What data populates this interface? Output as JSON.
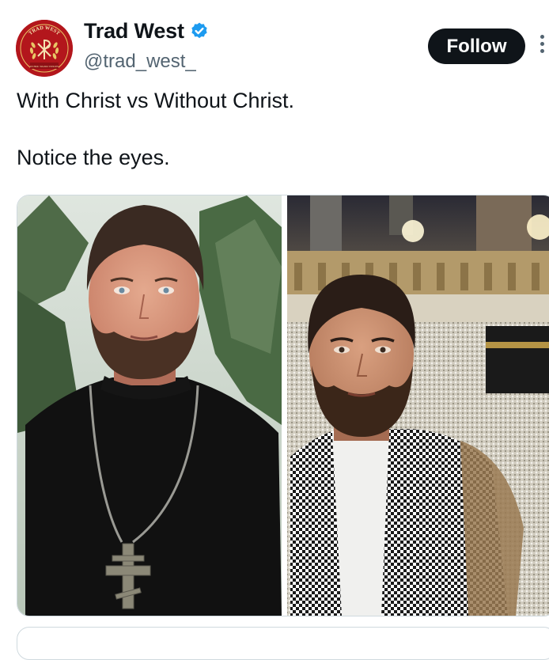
{
  "tweet": {
    "author_name": "Trad West",
    "verified": true,
    "handle": "@trad_west_",
    "follow_label": "Follow",
    "text_line1": "With Christ vs Without Christ.",
    "text_line2": "Notice the eyes.",
    "avatar_text_top": "TRAD WEST",
    "avatar_text_bottom": "IN HOC SIGNO VINCES"
  },
  "colors": {
    "verified_badge": "#1d9bf0",
    "follow_bg": "#0f1419",
    "avatar_bg": "#b3161c"
  },
  "icons": {
    "verified": "verified-badge-icon",
    "more": "more-options-icon",
    "avatar_emblem": "chi-rho-laurel-emblem"
  }
}
